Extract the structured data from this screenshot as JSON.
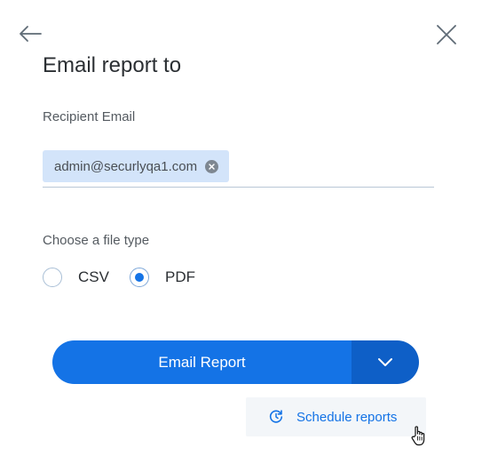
{
  "dialog": {
    "title": "Email report to",
    "recipient_label": "Recipient Email",
    "recipients": [
      "admin@securlyqa1.com"
    ],
    "file_type_label": "Choose a file type",
    "file_types": [
      {
        "label": "CSV",
        "selected": false
      },
      {
        "label": "PDF",
        "selected": true
      }
    ],
    "primary_action": "Email Report",
    "dropdown_options": [
      "Schedule reports"
    ]
  },
  "icons": {
    "back": "arrow-left-icon",
    "close": "close-icon",
    "chip_remove": "remove-circle-icon",
    "dropdown": "chevron-down-icon",
    "schedule": "refresh-clock-icon",
    "cursor": "hand-pointer-cursor"
  },
  "colors": {
    "primary": "#1473e6",
    "primary_dark": "#0e5fc7",
    "chip_bg": "#d3e4fa",
    "menu_bg": "#f3f6f9"
  }
}
